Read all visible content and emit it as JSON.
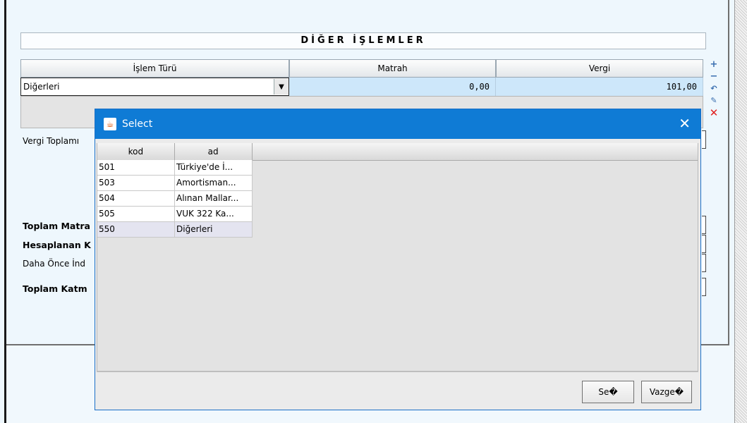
{
  "section": {
    "title": "DİĞER İŞLEMLER"
  },
  "grid": {
    "headers": [
      "İşlem Türü",
      "Matrah",
      "Vergi"
    ],
    "row": {
      "islem_turu": "Diğerleri",
      "matrah": "0,00",
      "vergi": "101,00"
    }
  },
  "labels": {
    "vergi_toplami": "Vergi Toplamı",
    "toplam_matrah": "Toplam Matra",
    "hesaplanan": "Hesaplanan K",
    "daha_once": "Daha Önce İnd",
    "toplam_katma": "Toplam Katm"
  },
  "toolbar_icons": [
    "plus-icon",
    "minus-icon",
    "undo-icon",
    "edit-icon",
    "delete-icon"
  ],
  "dialog": {
    "title": "Select",
    "columns": [
      "kod",
      "ad"
    ],
    "rows": [
      {
        "kod": "501",
        "ad": "Türkiye'de İ..."
      },
      {
        "kod": "503",
        "ad": "Amortisman..."
      },
      {
        "kod": "504",
        "ad": "Alınan Mallar..."
      },
      {
        "kod": "505",
        "ad": "VUK 322 Ka..."
      },
      {
        "kod": "550",
        "ad": "Diğerleri"
      }
    ],
    "buttons": {
      "select": "Se�",
      "cancel": "Vazge�"
    }
  },
  "colors": {
    "title_bar": "#0f7bd5",
    "cell_highlight": "#cde7fa",
    "delete": "#e02020"
  }
}
